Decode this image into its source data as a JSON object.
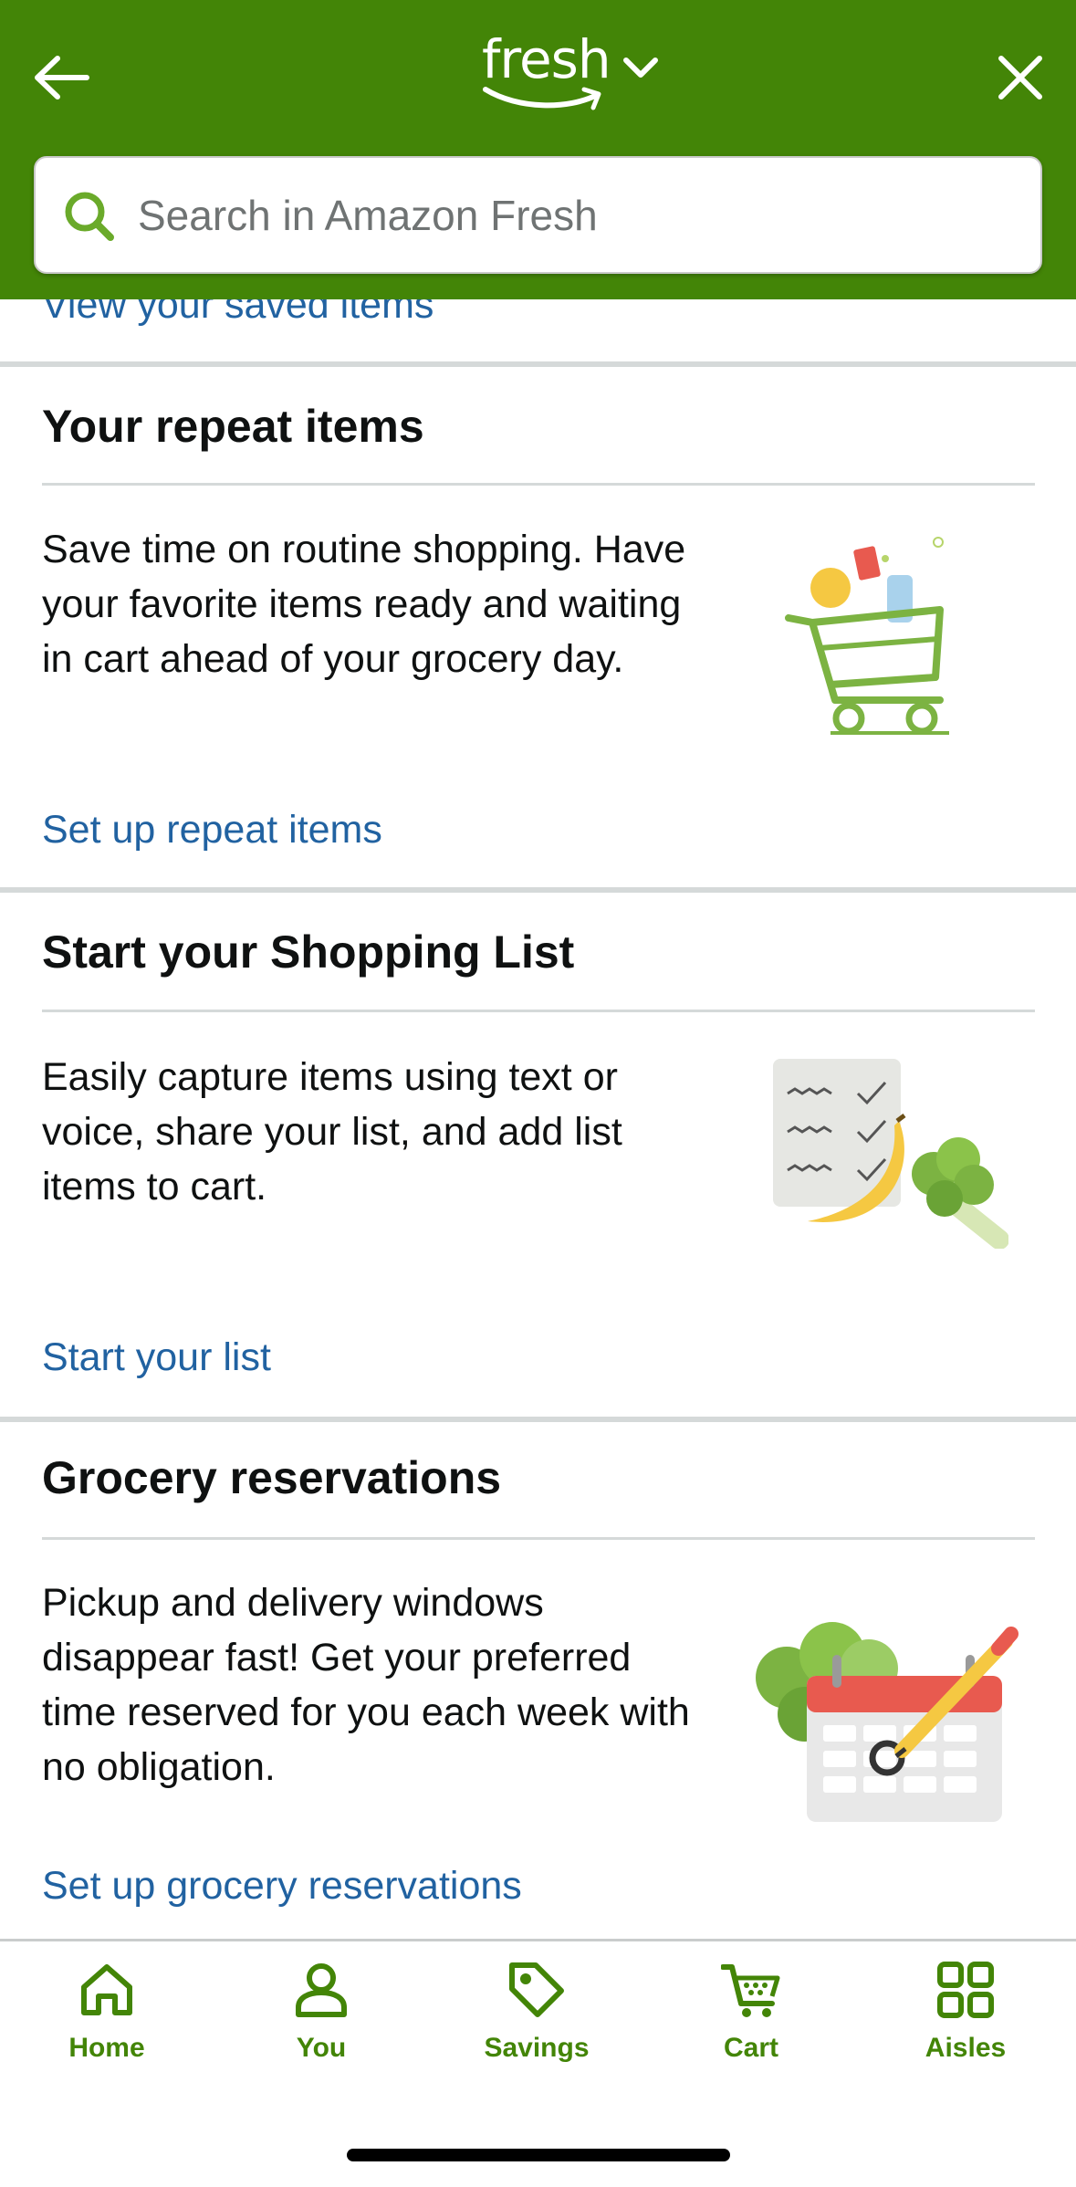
{
  "header": {
    "logo_text": "fresh",
    "search_placeholder": "Search in Amazon Fresh",
    "background_color": "#438507"
  },
  "partial_link": "View your saved items",
  "cards": [
    {
      "title": "Your repeat items",
      "description": "Save time on routine shopping. Have your favorite items ready and waiting in cart ahead of your grocery day.",
      "link": "Set up repeat items",
      "illustration": "shopping-cart-illustration"
    },
    {
      "title": "Start your Shopping List",
      "description": "Easily capture items using text or voice, share your list, and add list items to cart.",
      "link": "Start your list",
      "illustration": "shopping-list-illustration"
    },
    {
      "title": "Grocery reservations",
      "description": "Pickup and delivery windows disappear fast! Get your preferred time reserved for you each week with no obligation.",
      "link": "Set up grocery reservations",
      "illustration": "calendar-illustration"
    }
  ],
  "bottom_nav": [
    {
      "label": "Home",
      "icon": "home-icon"
    },
    {
      "label": "You",
      "icon": "person-icon"
    },
    {
      "label": "Savings",
      "icon": "tag-icon"
    },
    {
      "label": "Cart",
      "icon": "cart-icon"
    },
    {
      "label": "Aisles",
      "icon": "grid-icon"
    }
  ],
  "colors": {
    "accent_green": "#438507",
    "link_blue": "#2162a1"
  }
}
